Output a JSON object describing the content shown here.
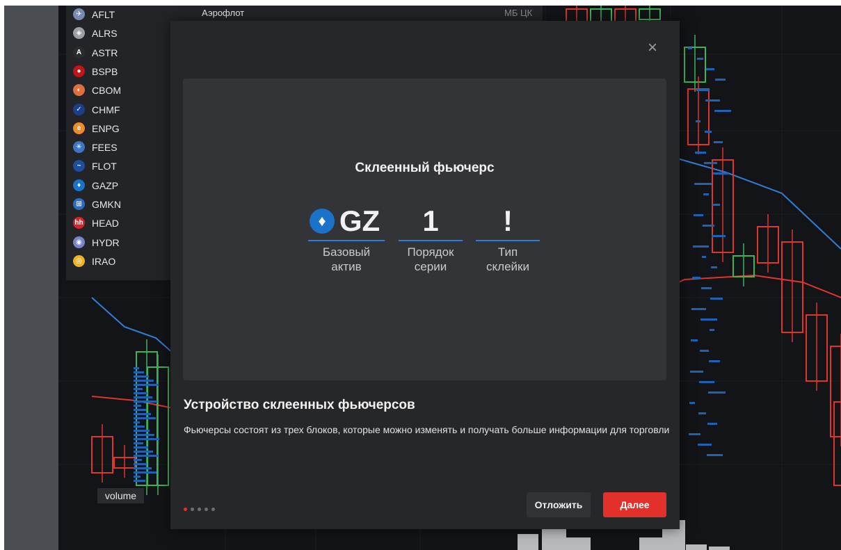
{
  "colors": {
    "accent_red": "#e3302b",
    "accent_blue": "#2f7fd6",
    "candle_up": "#3cb55a",
    "candle_down": "#e0342d"
  },
  "ticker_list": {
    "items": [
      {
        "symbol": "AFLT",
        "name": "Аэрофлот",
        "exchange": "МБ ЦК",
        "icon": "aeroflot-icon",
        "color": "#7a8bb0",
        "glyph": "✈"
      },
      {
        "symbol": "ALRS",
        "icon": "alrosa-icon",
        "color": "#9aa0a8",
        "glyph": "◈"
      },
      {
        "symbol": "ASTR",
        "icon": "astra-icon",
        "color": "#2a2c30",
        "glyph": "A"
      },
      {
        "symbol": "BSPB",
        "icon": "bspb-icon",
        "color": "#c0161b",
        "glyph": "●"
      },
      {
        "symbol": "CBOM",
        "icon": "mkb-icon",
        "color": "#e0703a",
        "glyph": "◐"
      },
      {
        "symbol": "CHMF",
        "icon": "severstal-icon",
        "color": "#1b3f8a",
        "glyph": "✓"
      },
      {
        "symbol": "ENPG",
        "icon": "enplus-icon",
        "color": "#f08b2a",
        "glyph": "e"
      },
      {
        "symbol": "FEES",
        "icon": "fsk-icon",
        "color": "#3d76c8",
        "glyph": "✳"
      },
      {
        "symbol": "FLOT",
        "icon": "sovcomflot-icon",
        "color": "#1d4f9a",
        "glyph": "~"
      },
      {
        "symbol": "GAZP",
        "icon": "gazprom-icon",
        "color": "#1a73c8",
        "glyph": "♦"
      },
      {
        "symbol": "GMKN",
        "icon": "nornickel-icon",
        "color": "#2b6fc4",
        "glyph": "⊞"
      },
      {
        "symbol": "HEAD",
        "icon": "headhunter-icon",
        "color": "#d5242b",
        "glyph": "hh"
      },
      {
        "symbol": "HYDR",
        "icon": "rushydro-icon",
        "color": "#7a84c8",
        "glyph": "◉"
      },
      {
        "symbol": "IRAO",
        "icon": "interrao-icon",
        "color": "#f0b21f",
        "glyph": "◎"
      }
    ]
  },
  "chart": {
    "volume_label": "volume"
  },
  "modal": {
    "close_icon": "×",
    "hero": {
      "title": "Склеенный фьючерс",
      "blocks": [
        {
          "value": "GZ",
          "caption_1": "Базовый",
          "caption_2": "актив"
        },
        {
          "value": "1",
          "caption_1": "Порядок",
          "caption_2": "серии"
        },
        {
          "value": "!",
          "caption_1": "Тип",
          "caption_2": "склейки"
        }
      ],
      "logo_icon": "gazprom-logo-icon"
    },
    "heading": "Устройство склеенных фьючерсов",
    "description": "Фьючерсы состоят из трех блоков, которые можно изменять и получать больше информации для торговли",
    "pager": {
      "total": 5,
      "active": 1
    },
    "postpone_label": "Отложить",
    "next_label": "Далее"
  }
}
